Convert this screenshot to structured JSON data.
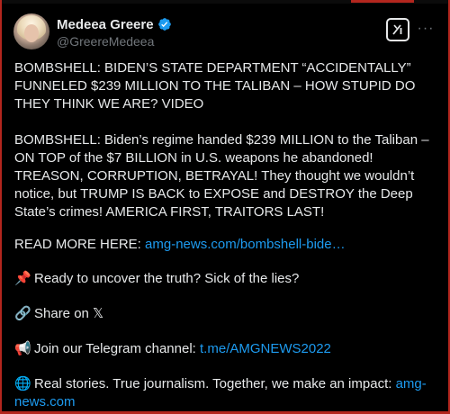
{
  "author": {
    "display_name": "Medeea Greere",
    "handle": "@GreereMedeea"
  },
  "icons": {
    "avatar": "profile-photo",
    "verified": "verified-badge-icon",
    "grok": "grok-icon",
    "more": "more-options-icon"
  },
  "colors": {
    "background": "#000000",
    "text": "#e7e9ea",
    "secondary_text": "#71767b",
    "link": "#1d9bf0",
    "verified": "#1d9bf0",
    "frame_accent": "#b3261e"
  },
  "more_label": "···",
  "post": {
    "headline": "BOMBSHELL: BIDEN’S STATE DEPARTMENT “ACCIDENTALLY” FUNNELED $239 MILLION TO THE TALIBAN – HOW STUPID DO THEY THINK WE ARE? VIDEO",
    "paragraph": "BOMBSHELL: Biden’s regime handed $239 MILLION to the Taliban – ON TOP of the $7 BILLION in U.S. weapons he abandoned! TREASON, CORRUPTION, BETRAYAL! They thought we wouldn’t notice, but TRUMP IS BACK to EXPOSE and DESTROY the Deep State’s crimes! AMERICA FIRST, TRAITORS LAST!",
    "read_more_label": "READ MORE HERE:",
    "read_more_link": "amg-news.com/bombshell-bide…",
    "uncover_emoji": "📌",
    "uncover_text": "Ready to uncover the truth? Sick of the lies?",
    "share_emoji": "🔗",
    "share_text": "Share on 𝕏",
    "telegram_emoji": "📢",
    "telegram_text": "Join our Telegram channel:",
    "telegram_link": "t.me/AMGNEWS2022",
    "stories_emoji": "🌐",
    "stories_text": "Real stories. True journalism. Together, we make an impact:",
    "stories_link": "amg-news.com"
  }
}
